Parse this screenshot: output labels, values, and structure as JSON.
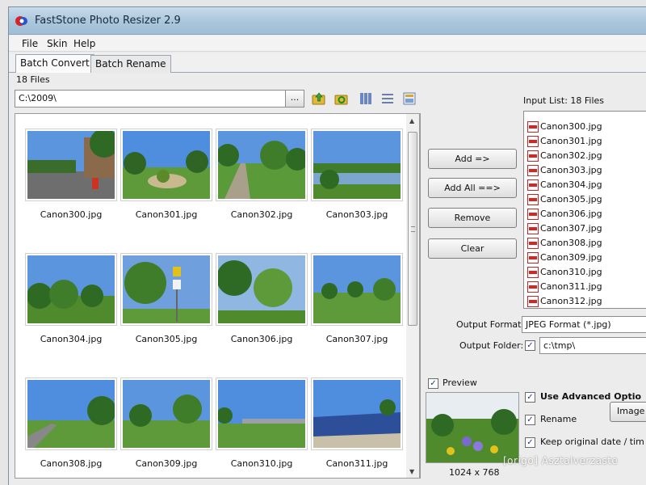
{
  "window": {
    "title": "FastStone Photo Resizer 2.9"
  },
  "menu": [
    "File",
    "Skin",
    "Help"
  ],
  "tabs": [
    {
      "label": "Batch Convert",
      "active": true
    },
    {
      "label": "Batch Rename",
      "active": false
    }
  ],
  "browser": {
    "files_count": "18 Files",
    "path": "C:\\2009\\",
    "browse_label": "...",
    "thumbnails": [
      "Canon300.jpg",
      "Canon301.jpg",
      "Canon302.jpg",
      "Canon303.jpg",
      "Canon304.jpg",
      "Canon305.jpg",
      "Canon306.jpg",
      "Canon307.jpg",
      "Canon308.jpg",
      "Canon309.jpg",
      "Canon310.jpg",
      "Canon311.jpg"
    ]
  },
  "buttons": {
    "add": "Add =>",
    "add_all": "Add All ==>",
    "remove": "Remove",
    "clear": "Clear"
  },
  "input_list": {
    "label": "Input List:  18 Files",
    "items": [
      "Canon300.jpg",
      "Canon301.jpg",
      "Canon302.jpg",
      "Canon303.jpg",
      "Canon304.jpg",
      "Canon305.jpg",
      "Canon306.jpg",
      "Canon307.jpg",
      "Canon308.jpg",
      "Canon309.jpg",
      "Canon310.jpg",
      "Canon311.jpg",
      "Canon312.jpg"
    ]
  },
  "output": {
    "format_label": "Output Format:",
    "format_value": "JPEG Format (*.jpg)",
    "folder_label": "Output Folder:",
    "folder_value": "c:\\tmp\\",
    "folder_checked": true
  },
  "preview": {
    "label": "Preview",
    "checked": true,
    "dimensions": "1024 x 768"
  },
  "options": {
    "use_advanced": "Use Advanced Optio",
    "rename": "Rename",
    "image_button": "Image",
    "keep_date": "Keep original date / tim"
  },
  "watermark": "[origo] Asztalverzaste",
  "colors": {
    "sky": "#4a86d8",
    "grass": "#3f7d2a",
    "title_bar": "#a9c6dc"
  }
}
